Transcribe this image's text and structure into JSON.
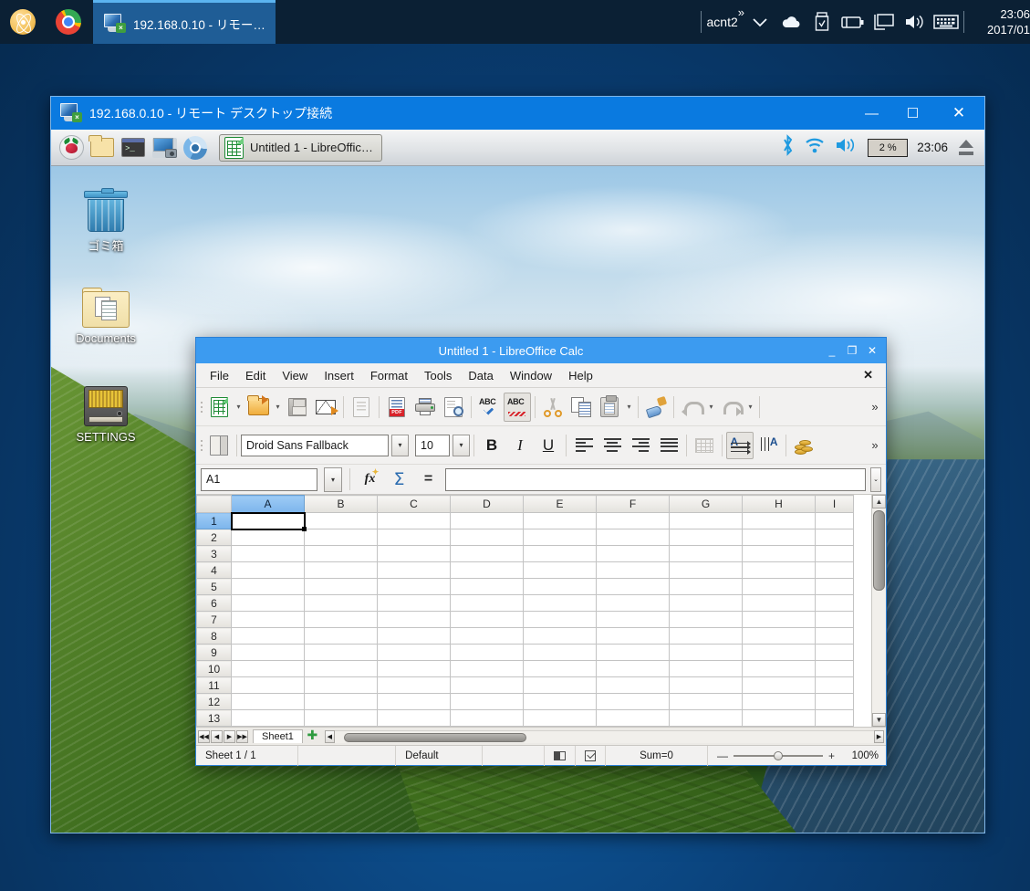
{
  "windows_taskbar": {
    "launchers": [
      {
        "name": "atom-icon",
        "label": "Atom"
      },
      {
        "name": "chrome-icon",
        "label": "Google Chrome"
      }
    ],
    "task_button": {
      "label": "192.168.0.10 - リモー…",
      "icon": "remote-desktop-icon"
    },
    "tray": {
      "user": "acnt2",
      "overflow_chevron": "»",
      "expand_chevron": "⌄",
      "icons": [
        "onedrive-cloud-icon",
        "usb-drive-icon",
        "battery-icon",
        "monitor-icon",
        "volume-icon",
        "keyboard-icon"
      ],
      "clock_time": "23:06",
      "clock_date": "2017/01"
    }
  },
  "rdp_window": {
    "title": "192.168.0.10 - リモート デスクトップ接続",
    "icon": "remote-desktop-icon",
    "controls": {
      "minimize": "—",
      "maximize": "☐",
      "close": "✕"
    }
  },
  "pi_taskbar": {
    "launchers": [
      {
        "name": "raspberry-menu-icon",
        "label": "Menu"
      },
      {
        "name": "file-manager-icon",
        "label": "File Manager"
      },
      {
        "name": "terminal-icon",
        "label": "Terminal"
      },
      {
        "name": "screenshot-icon",
        "label": "Screenshot"
      },
      {
        "name": "chromium-icon",
        "label": "Chromium"
      }
    ],
    "terminal_prompt": ">_",
    "task_button": {
      "label": "Untitled 1 - LibreOffic…",
      "icon": "calc-document-icon"
    },
    "tray": {
      "bluetooth": "bluetooth-icon",
      "wifi": "wifi-icon",
      "volume": "volume-icon",
      "cpu_label": "2 %",
      "clock": "23:06",
      "eject": "eject-icon"
    }
  },
  "pi_desktop": {
    "icons": [
      {
        "name": "desktop-icon-trash",
        "label": "ゴミ箱",
        "glyph": "trash-icon"
      },
      {
        "name": "desktop-icon-documents",
        "label": "Documents",
        "glyph": "folder-icon"
      },
      {
        "name": "desktop-icon-settings",
        "label": "SETTINGS",
        "glyph": "drive-icon"
      }
    ]
  },
  "calc": {
    "title": "Untitled 1 - LibreOffice Calc",
    "controls": {
      "minimize": "_",
      "maximize": "❐",
      "close": "✕"
    },
    "menu": [
      "File",
      "Edit",
      "View",
      "Insert",
      "Format",
      "Tools",
      "Data",
      "Window",
      "Help"
    ],
    "doc_close": "✕",
    "standard_toolbar": [
      "new-document-button",
      "open-button",
      "save-button",
      "email-button",
      "edit-mode-button",
      "export-pdf-button",
      "print-button",
      "print-preview-button",
      "spelling-button",
      "autospellcheck-button",
      "cut-button",
      "copy-button",
      "paste-button",
      "clone-formatting-button",
      "undo-button",
      "redo-button"
    ],
    "toolbar_overflow": "»",
    "format_toolbar": {
      "sidebar_button": "sidebar-settings-button",
      "font_name": "Droid Sans Fallback",
      "font_size": "10",
      "bold": "B",
      "italic": "I",
      "underline": "U",
      "align": [
        "align-left-button",
        "align-center-button",
        "align-right-button",
        "align-justified-button"
      ],
      "merge": "merge-cells-button",
      "text_direction_ltr": "text-direction-ltr-button",
      "text_direction_ttb": "text-direction-ttb-button",
      "currency": "format-currency-button",
      "overflow": "»"
    },
    "formula_bar": {
      "name_box": "A1",
      "name_box_dropdown": "⌄",
      "function_wizard": "fx",
      "sum": "Σ",
      "equals": "=",
      "input_value": "",
      "input_placeholder": "",
      "expand": "⌄"
    },
    "grid": {
      "columns": [
        "A",
        "B",
        "C",
        "D",
        "E",
        "F",
        "G",
        "H",
        "I"
      ],
      "rows": [
        "1",
        "2",
        "3",
        "4",
        "5",
        "6",
        "7",
        "8",
        "9",
        "10",
        "11",
        "12",
        "13"
      ],
      "selected_cell": "A1",
      "selected_column": "A",
      "selected_row": "1",
      "cell_values": {}
    },
    "sheet_tabs": {
      "nav_first": "◀◀",
      "nav_prev": "◀",
      "nav_next": "▶",
      "nav_last": "▶▶",
      "tabs": [
        "Sheet1"
      ],
      "add_sheet": "✚"
    },
    "status_bar": {
      "sheet_count": "Sheet 1 / 1",
      "page_style": "Default",
      "selection_mode_icon": "selection-mode-icon",
      "modified_icon": "document-modified-icon",
      "sum": "Sum=0",
      "zoom_minus": "—",
      "zoom_plus": "+",
      "zoom_percent": "100%"
    }
  },
  "colors": {
    "win_taskbar_bg": "#0b2034",
    "win_task_active": "#1f5d96",
    "rdp_title_bg": "#0a7ae0",
    "calc_title_bg": "#3c9bf0",
    "grid_selection_blue": "#7cb5ec",
    "accent_green": "#1d8a34"
  }
}
